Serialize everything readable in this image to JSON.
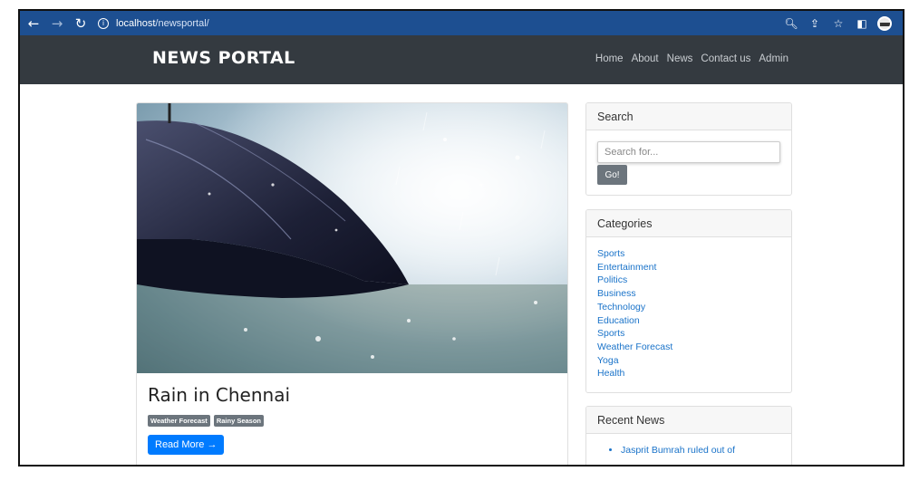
{
  "browser": {
    "url_host": "localhost",
    "url_path": "/newsportal/"
  },
  "site": {
    "brand": "NEWS PORTAL",
    "nav": [
      "Home",
      "About",
      "News",
      "Contact us",
      "Admin"
    ]
  },
  "post": {
    "title": "Rain in Chennai",
    "tags": [
      "Weather Forecast",
      "Rainy Season"
    ],
    "read_more": "Read More →"
  },
  "sidebar": {
    "search": {
      "heading": "Search",
      "placeholder": "Search for...",
      "button": "Go!"
    },
    "categories": {
      "heading": "Categories",
      "items": [
        "Sports",
        "Entertainment",
        "Politics",
        "Business",
        "Technology",
        "Education",
        "Sports",
        "Weather Forecast",
        "Yoga",
        "Health"
      ]
    },
    "recent": {
      "heading": "Recent News",
      "items": [
        "Jasprit Bumrah ruled out of"
      ]
    }
  },
  "colors": {
    "browser_bar": "#1d4f91",
    "navbar": "#343a40",
    "link": "#1a73c9",
    "primary_button": "#007bff",
    "secondary": "#6c757d"
  }
}
